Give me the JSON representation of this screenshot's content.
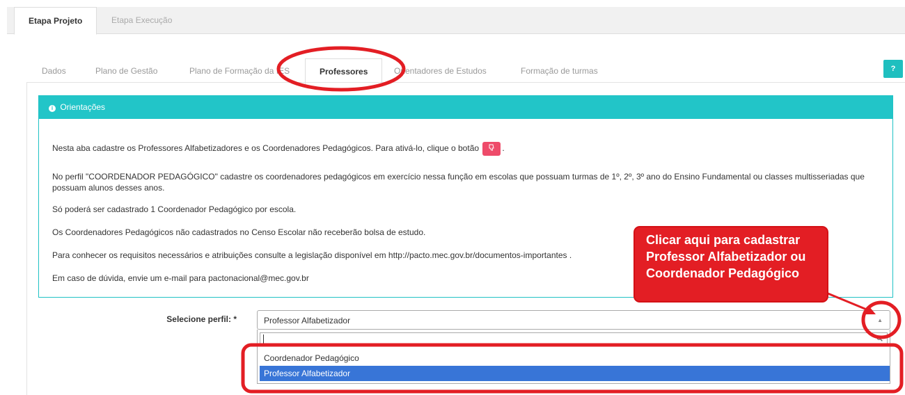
{
  "stage_tabs": [
    {
      "label": "Etapa Projeto",
      "active": true
    },
    {
      "label": "Etapa Execução",
      "active": false
    }
  ],
  "sub_tabs": [
    {
      "label": "Dados"
    },
    {
      "label": "Plano de Gestão"
    },
    {
      "label": "Plano de Formação da IES"
    },
    {
      "label": "Professores",
      "active": true
    },
    {
      "label": "Orientadores de Estudos"
    },
    {
      "label": "Formação de turmas"
    }
  ],
  "help_label": "?",
  "panel": {
    "title": "Orientações",
    "p1_before": "Nesta aba cadastre os Professores Alfabetizadores e os Coordenadores Pedagógicos. Para ativá-lo, clique o botão",
    "p1_after": ".",
    "p2": "No perfil \"COORDENADOR PEDAGÓGICO\" cadastre os coordenadores pedagógicos em exercício nessa função em escolas que possuam turmas de 1º, 2º, 3º ano do Ensino Fundamental ou  classes multisseriadas que possuam alunos desses anos.",
    "p3": "Só poderá ser cadastrado 1 Coordenador Pedagógico por escola.",
    "p4": "Os Coordenadores Pedagógicos não cadastrados no Censo Escolar não receberão bolsa de estudo.",
    "p5": "Para conhecer os requisitos necessários e atribuições consulte a legislação disponível em http://pacto.mec.gov.br/documentos-importantes .",
    "p6": "Em caso de dúvida, envie um e-mail para pactonacional@mec.gov.br"
  },
  "form": {
    "label": "Selecione perfil: *",
    "selected": "Professor Alfabetizador",
    "search_value": "",
    "options": [
      "Coordenador Pedagógico",
      "Professor Alfabetizador"
    ]
  },
  "callout": {
    "line1": "Clicar aqui para cadastrar",
    "line2": "Professor Alfabetizador ou",
    "line3": "Coordenador Pedagógico"
  },
  "colors": {
    "accent": "#22c5c8",
    "annotation": "#e31e24",
    "highlight": "#3875d7",
    "button": "#ee4b6a"
  },
  "icons": {
    "panel": "info-icon",
    "activate_button": "thumbs-down-icon",
    "select_arrow": "caret-up-icon",
    "search": "search-icon"
  }
}
